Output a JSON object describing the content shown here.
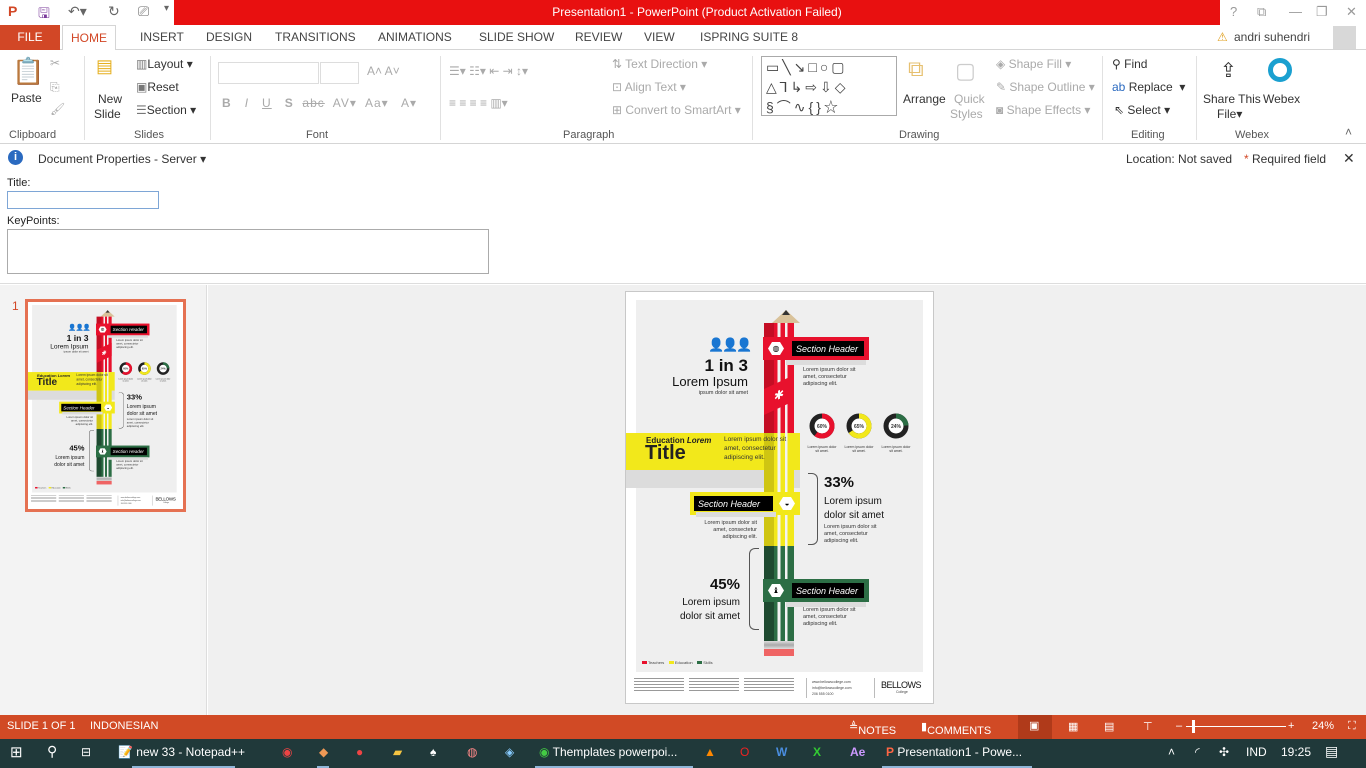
{
  "window": {
    "title": "Presentation1 - PowerPoint (Product Activation Failed)",
    "controls": [
      "?",
      "⧉",
      "—",
      "❐",
      "✕"
    ]
  },
  "quick_access": [
    "save-icon",
    "undo-icon",
    "redo-icon",
    "present-icon"
  ],
  "tabs": [
    "FILE",
    "HOME",
    "INSERT",
    "DESIGN",
    "TRANSITIONS",
    "ANIMATIONS",
    "SLIDE SHOW",
    "REVIEW",
    "VIEW",
    "ISPRING SUITE 8"
  ],
  "active_tab": "HOME",
  "user": "andri suhendri",
  "ribbon": {
    "clipboard": {
      "label": "Clipboard",
      "paste": "Paste"
    },
    "slides": {
      "label": "Slides",
      "new_slide": "New",
      "new_slide2": "Slide",
      "layout": "Layout",
      "reset": "Reset",
      "section": "Section"
    },
    "font": {
      "label": "Font",
      "buttons": [
        "B",
        "I",
        "U",
        "S",
        "abc",
        "AV",
        "Aa",
        "A"
      ]
    },
    "paragraph": {
      "label": "Paragraph",
      "text_direction": "Text Direction",
      "align_text": "Align Text",
      "convert": "Convert to SmartArt"
    },
    "drawing": {
      "label": "Drawing",
      "arrange": "Arrange",
      "quick_styles": "Quick",
      "quick_styles2": "Styles",
      "shape_fill": "Shape Fill",
      "shape_outline": "Shape Outline",
      "shape_effects": "Shape Effects"
    },
    "editing": {
      "label": "Editing",
      "find": "Find",
      "replace": "Replace",
      "select": "Select"
    },
    "webex": {
      "label": "Webex",
      "share": "Share This",
      "share2": "File",
      "webex": "Webex"
    }
  },
  "docprops": {
    "title": "Document Properties - Server",
    "location": "Location: Not saved",
    "required": "Required field",
    "title_label": "Title:",
    "title_value": "",
    "keypoints_label": "KeyPoints:",
    "keypoints_value": ""
  },
  "thumbnail_number": "1",
  "slide": {
    "stat1": "1 in 3",
    "stat1_sub": "Lorem Ipsum",
    "stat1_small": "ipsum dolor sit amet",
    "section_header": "Section Header",
    "body": "Lorem ipsum dolor sit amet, consectetur adipiscing elit.",
    "edu_small": "Education",
    "edu_italic": "Lorem",
    "edu_title": "Title",
    "edu_body": "Lorem ipsum dolor sit amet, consectetur adipiscing elit.",
    "donuts": [
      {
        "label": "60%",
        "value": 60,
        "color": "#E8112D"
      },
      {
        "label": "65%",
        "value": 65,
        "color": "#F2E81B"
      },
      {
        "label": "24%",
        "value": 24,
        "color": "#2C6E45"
      }
    ],
    "donut_caption": "Lorem ipsum dolor sit amet.",
    "stat2": "33%",
    "stat2_sub": "Lorem ipsum dolor sit amet",
    "stat3": "45%",
    "stat3_sub": "Lorem ipsum dolor sit amet",
    "legend": [
      {
        "label": "Teachers",
        "color": "#E8112D"
      },
      {
        "label": "Education",
        "color": "#F2E81B"
      },
      {
        "label": "Skills",
        "color": "#2C6E45"
      }
    ],
    "footer_contacts": [
      "www.bellowscollege.com",
      "info@bellowscollege.com",
      "206 555 0100"
    ],
    "brand": "BELLOWS",
    "brand_sub": "College"
  },
  "status": {
    "slide": "SLIDE 1 OF 1",
    "language": "INDONESIAN",
    "notes": "NOTES",
    "comments": "COMMENTS",
    "zoom": "24%"
  },
  "taskbar": {
    "notepad": "new 33 - Notepad++",
    "chrome": "Themplates powerpoi...",
    "ppt": "Presentation1 - Powe...",
    "lang": "IND",
    "time": "19:25"
  }
}
